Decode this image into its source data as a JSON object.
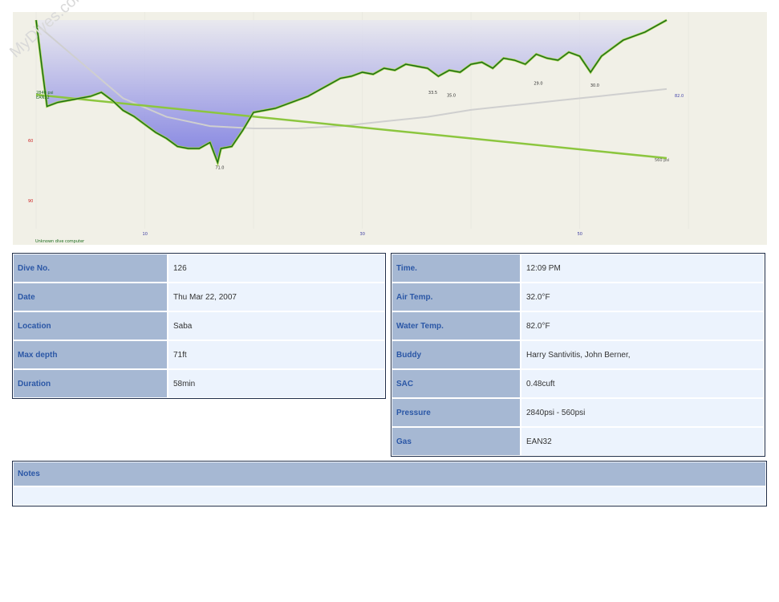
{
  "watermark": "MyDives.com",
  "profile": {
    "computer_label": "Unknown dive computer",
    "start_pressure_label": "2840 psi",
    "gas_label": "EAN32",
    "end_pressure_label": "560 psi",
    "temp_label": "82.0",
    "colors": {
      "depth": "#1a6a1a",
      "pressure": "#8cc63f",
      "temp": "#cccccc",
      "fill": "#7f7fe0"
    }
  },
  "chart_data": {
    "type": "line",
    "xlabel": "",
    "ylabel": "",
    "x_ticks": [
      "10",
      "30",
      "50"
    ],
    "y_ticks": [
      "60",
      "90"
    ],
    "depth_annotations": [
      {
        "time": 16.7,
        "depth": 71.0,
        "label": "71.0"
      },
      {
        "time": 36.3,
        "depth": 33.5,
        "label": "33.5"
      },
      {
        "time": 38.0,
        "depth": 35.0,
        "label": "35.0"
      },
      {
        "time": 46.0,
        "depth": 29.0,
        "label": "29.0"
      },
      {
        "time": 51.2,
        "depth": 30.0,
        "label": "30.0"
      }
    ],
    "series": [
      {
        "name": "Depth",
        "x": [
          0,
          0.5,
          1,
          2,
          3,
          4,
          5,
          6,
          7,
          8,
          9,
          10,
          11,
          12,
          13,
          14,
          15,
          16,
          16.7,
          17,
          18,
          19,
          20,
          21,
          22,
          23,
          24,
          25,
          26,
          27,
          28,
          29,
          30,
          31,
          32,
          33,
          34,
          35,
          36,
          37,
          38,
          39,
          40,
          41,
          42,
          43,
          44,
          45,
          46,
          47,
          48,
          49,
          50,
          51,
          52,
          53,
          54,
          55,
          56,
          57,
          58
        ],
        "y": [
          0,
          22,
          43,
          41,
          40,
          39,
          38,
          36,
          40,
          45,
          48,
          52,
          56,
          59,
          63,
          64,
          64,
          61,
          71,
          64,
          63,
          55,
          46,
          45,
          44,
          42,
          40,
          38,
          35,
          32,
          29,
          28,
          26,
          27,
          24,
          25,
          22,
          23,
          24,
          28,
          25,
          26,
          22,
          21,
          24,
          19,
          20,
          22,
          17,
          19,
          20,
          16,
          18,
          26,
          18,
          14,
          10,
          8,
          6,
          3,
          0
        ]
      },
      {
        "name": "Pressure",
        "x": [
          0,
          58
        ],
        "y": [
          2840,
          560
        ]
      },
      {
        "name": "Temperature",
        "x": [
          0,
          1,
          3,
          5,
          8,
          12,
          16,
          20,
          24,
          28,
          32,
          36,
          40,
          44,
          48,
          52,
          56,
          58
        ],
        "y": [
          82,
          80,
          76,
          72,
          66,
          62,
          60,
          59.5,
          59.5,
          60,
          61,
          62,
          63.5,
          64.5,
          65.5,
          66.5,
          67.5,
          68
        ]
      }
    ]
  },
  "details_left": [
    {
      "label": "Dive No.",
      "value": "126"
    },
    {
      "label": "Date",
      "value": "Thu Mar 22, 2007"
    },
    {
      "label": "Location",
      "value": "Saba"
    },
    {
      "label": "Max depth",
      "value": "71ft"
    },
    {
      "label": "Duration",
      "value": "58min"
    }
  ],
  "details_right": [
    {
      "label": "Time.",
      "value": "12:09 PM"
    },
    {
      "label": "Air Temp.",
      "value": "32.0°F"
    },
    {
      "label": "Water Temp.",
      "value": "82.0°F"
    },
    {
      "label": "Buddy",
      "value": "Harry Santivitis, John Berner,"
    },
    {
      "label": "SAC",
      "value": "0.48cuft"
    },
    {
      "label": "Pressure",
      "value": "2840psi - 560psi"
    },
    {
      "label": "Gas",
      "value": "EAN32"
    }
  ],
  "notes": {
    "label": "Notes",
    "text": ""
  }
}
